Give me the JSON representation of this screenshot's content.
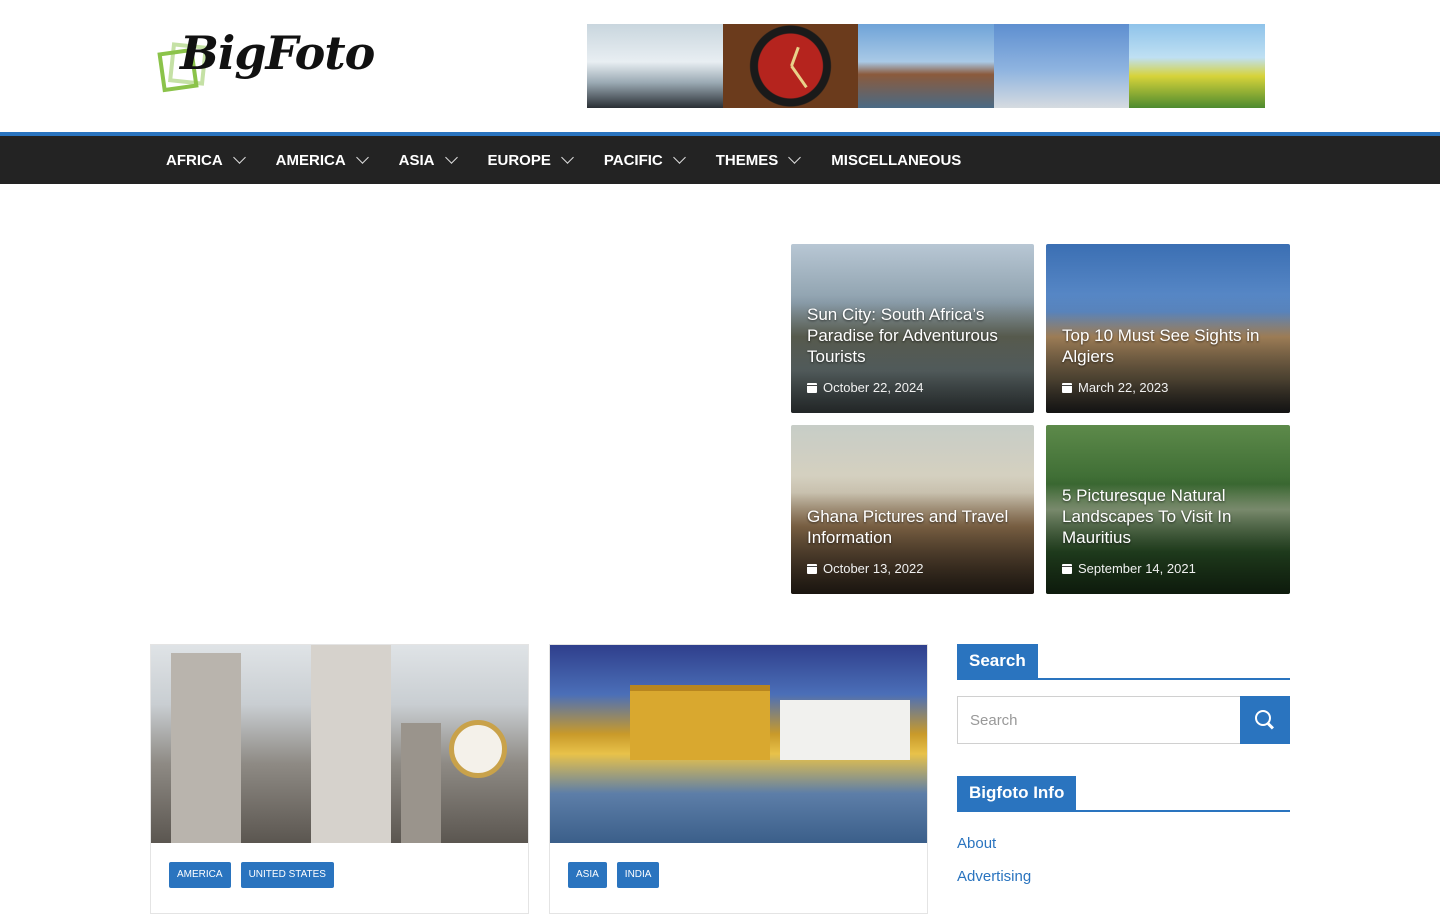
{
  "site": {
    "logo_text": "BigFoto"
  },
  "nav": {
    "items": [
      {
        "label": "AFRICA",
        "has_menu": true
      },
      {
        "label": "AMERICA",
        "has_menu": true
      },
      {
        "label": "ASIA",
        "has_menu": true
      },
      {
        "label": "EUROPE",
        "has_menu": true
      },
      {
        "label": "PACIFIC",
        "has_menu": true
      },
      {
        "label": "THEMES",
        "has_menu": true
      },
      {
        "label": "MISCELLANEOUS",
        "has_menu": false
      }
    ]
  },
  "featured": [
    {
      "title": "Sun City: South Africa’s Paradise for Adventurous Tourists",
      "date": "October 22, 2024"
    },
    {
      "title": "Top 10 Must See Sights in Algiers",
      "date": "March 22, 2023"
    },
    {
      "title": "Ghana Pictures and Travel Information",
      "date": "October 13, 2022"
    },
    {
      "title": "5 Picturesque Natural Landscapes To Visit In Mauritius",
      "date": "September 14, 2021"
    }
  ],
  "posts": [
    {
      "tags": [
        "AMERICA",
        "UNITED STATES"
      ]
    },
    {
      "tags": [
        "ASIA",
        "INDIA"
      ]
    }
  ],
  "sidebar": {
    "search_title": "Search",
    "search_placeholder": "Search",
    "info_title": "Bigfoto Info",
    "links": [
      "About",
      "Advertising"
    ]
  },
  "colors": {
    "accent": "#2a74bf",
    "nav_bg": "#232323"
  }
}
